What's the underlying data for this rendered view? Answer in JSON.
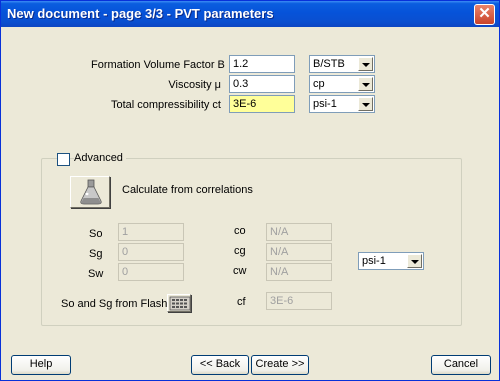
{
  "window": {
    "title": "New document - page 3/3 - PVT parameters",
    "close_icon": "close-icon"
  },
  "params": {
    "fvf_label": "Formation Volume Factor B",
    "fvf_value": "1.2",
    "fvf_unit": "B/STB",
    "visc_label": "Viscosity μ",
    "visc_value": "0.3",
    "visc_unit": "cp",
    "comp_label": "Total compressibility ct",
    "comp_value": "3E-6",
    "comp_unit": "psi-1"
  },
  "advanced": {
    "checkbox_label": "Advanced",
    "calc_label": "Calculate from correlations",
    "calc_icon": "flask-icon",
    "so_label": "So",
    "so_value": "1",
    "sg_label": "Sg",
    "sg_value": "0",
    "sw_label": "Sw",
    "sw_value": "0",
    "co_label": "co",
    "co_value": "N/A",
    "cg_label": "cg",
    "cg_value": "N/A",
    "cw_label": "cw",
    "cw_value": "N/A",
    "cf_label": "cf",
    "cf_value": "3E-6",
    "unit_value": "psi-1",
    "flash_label": "So and Sg from Flash",
    "flash_icon": "calculator-icon"
  },
  "buttons": {
    "help": "Help",
    "back": "<< Back",
    "create": "Create >>",
    "cancel": "Cancel"
  }
}
